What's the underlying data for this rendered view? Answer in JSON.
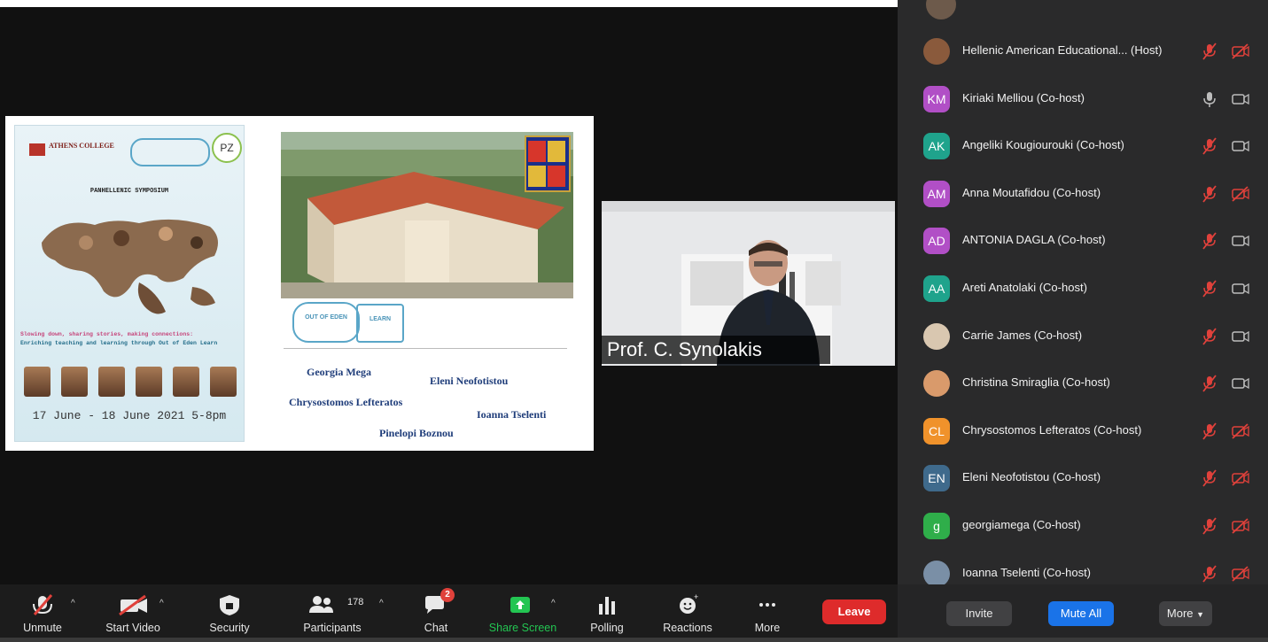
{
  "slide": {
    "poster": {
      "college": "ATHENS COLLEGE",
      "symposium": "PANHELLENIC SYMPOSIUM",
      "tagline": "Slowing down, sharing stories, making connections:",
      "subtitle": "Enriching teaching and learning through Out of Eden Learn",
      "dates": "17 June - 18 June 2021 5-8pm",
      "pz_logo": "PZ"
    },
    "stamps": {
      "out_of_eden": "OUT OF EDEN",
      "learn": "LEARN"
    },
    "names": [
      "Georgia Mega",
      "Eleni Neofotistou",
      "Chrysostomos Lefteratos",
      "Ioanna Tselenti",
      "Pinelopi Boznou"
    ]
  },
  "speaker": {
    "name_label": "Prof. C. Synolakis"
  },
  "participants": [
    {
      "name": "Hellenic American Educational... (Host)",
      "avatar_text": "",
      "avatar_color": "#8a5a3c",
      "mic": "muted",
      "video": "off"
    },
    {
      "name": "Kiriaki Melliou (Co-host)",
      "avatar_text": "KM",
      "avatar_color": "#b14fc6",
      "mic": "on",
      "video": "on"
    },
    {
      "name": "Angeliki Kougiourouki (Co-host)",
      "avatar_text": "AK",
      "avatar_color": "#1fa38c",
      "mic": "muted",
      "video": "on"
    },
    {
      "name": "Anna Moutafidou (Co-host)",
      "avatar_text": "AM",
      "avatar_color": "#b14fc6",
      "mic": "muted",
      "video": "off"
    },
    {
      "name": "ANTONIA DAGLA (Co-host)",
      "avatar_text": "AD",
      "avatar_color": "#b14fc6",
      "mic": "muted",
      "video": "on"
    },
    {
      "name": "Areti Anatolaki (Co-host)",
      "avatar_text": "AA",
      "avatar_color": "#1fa38c",
      "mic": "muted",
      "video": "on"
    },
    {
      "name": "Carrie James (Co-host)",
      "avatar_text": "",
      "avatar_color": "#d9c7b0",
      "mic": "muted",
      "video": "on"
    },
    {
      "name": "Christina Smiraglia (Co-host)",
      "avatar_text": "",
      "avatar_color": "#d99a6b",
      "mic": "muted",
      "video": "on"
    },
    {
      "name": "Chrysostomos Lefteratos (Co-host)",
      "avatar_text": "CL",
      "avatar_color": "#f0922b",
      "mic": "muted",
      "video": "off"
    },
    {
      "name": "Eleni Neofotistou (Co-host)",
      "avatar_text": "EN",
      "avatar_color": "#3f6a8c",
      "mic": "muted",
      "video": "off"
    },
    {
      "name": "georgiamega (Co-host)",
      "avatar_text": "g",
      "avatar_color": "#2fae4a",
      "mic": "muted",
      "video": "off"
    },
    {
      "name": "Ioanna Tselenti (Co-host)",
      "avatar_text": "",
      "avatar_color": "#7a8fa6",
      "mic": "muted",
      "video": "off"
    }
  ],
  "panel_footer": {
    "invite": "Invite",
    "mute_all": "Mute All",
    "more": "More"
  },
  "toolbar": {
    "unmute": "Unmute",
    "start_video": "Start Video",
    "security": "Security",
    "participants": "Participants",
    "participants_count": "178",
    "chat": "Chat",
    "chat_badge": "2",
    "share_screen": "Share Screen",
    "polling": "Polling",
    "reactions": "Reactions",
    "more": "More",
    "leave": "Leave"
  },
  "colors": {
    "leave": "#de2b2b",
    "share_green": "#23c552",
    "mute_all_blue": "#1a73e8",
    "muted_red": "#e0413b"
  }
}
